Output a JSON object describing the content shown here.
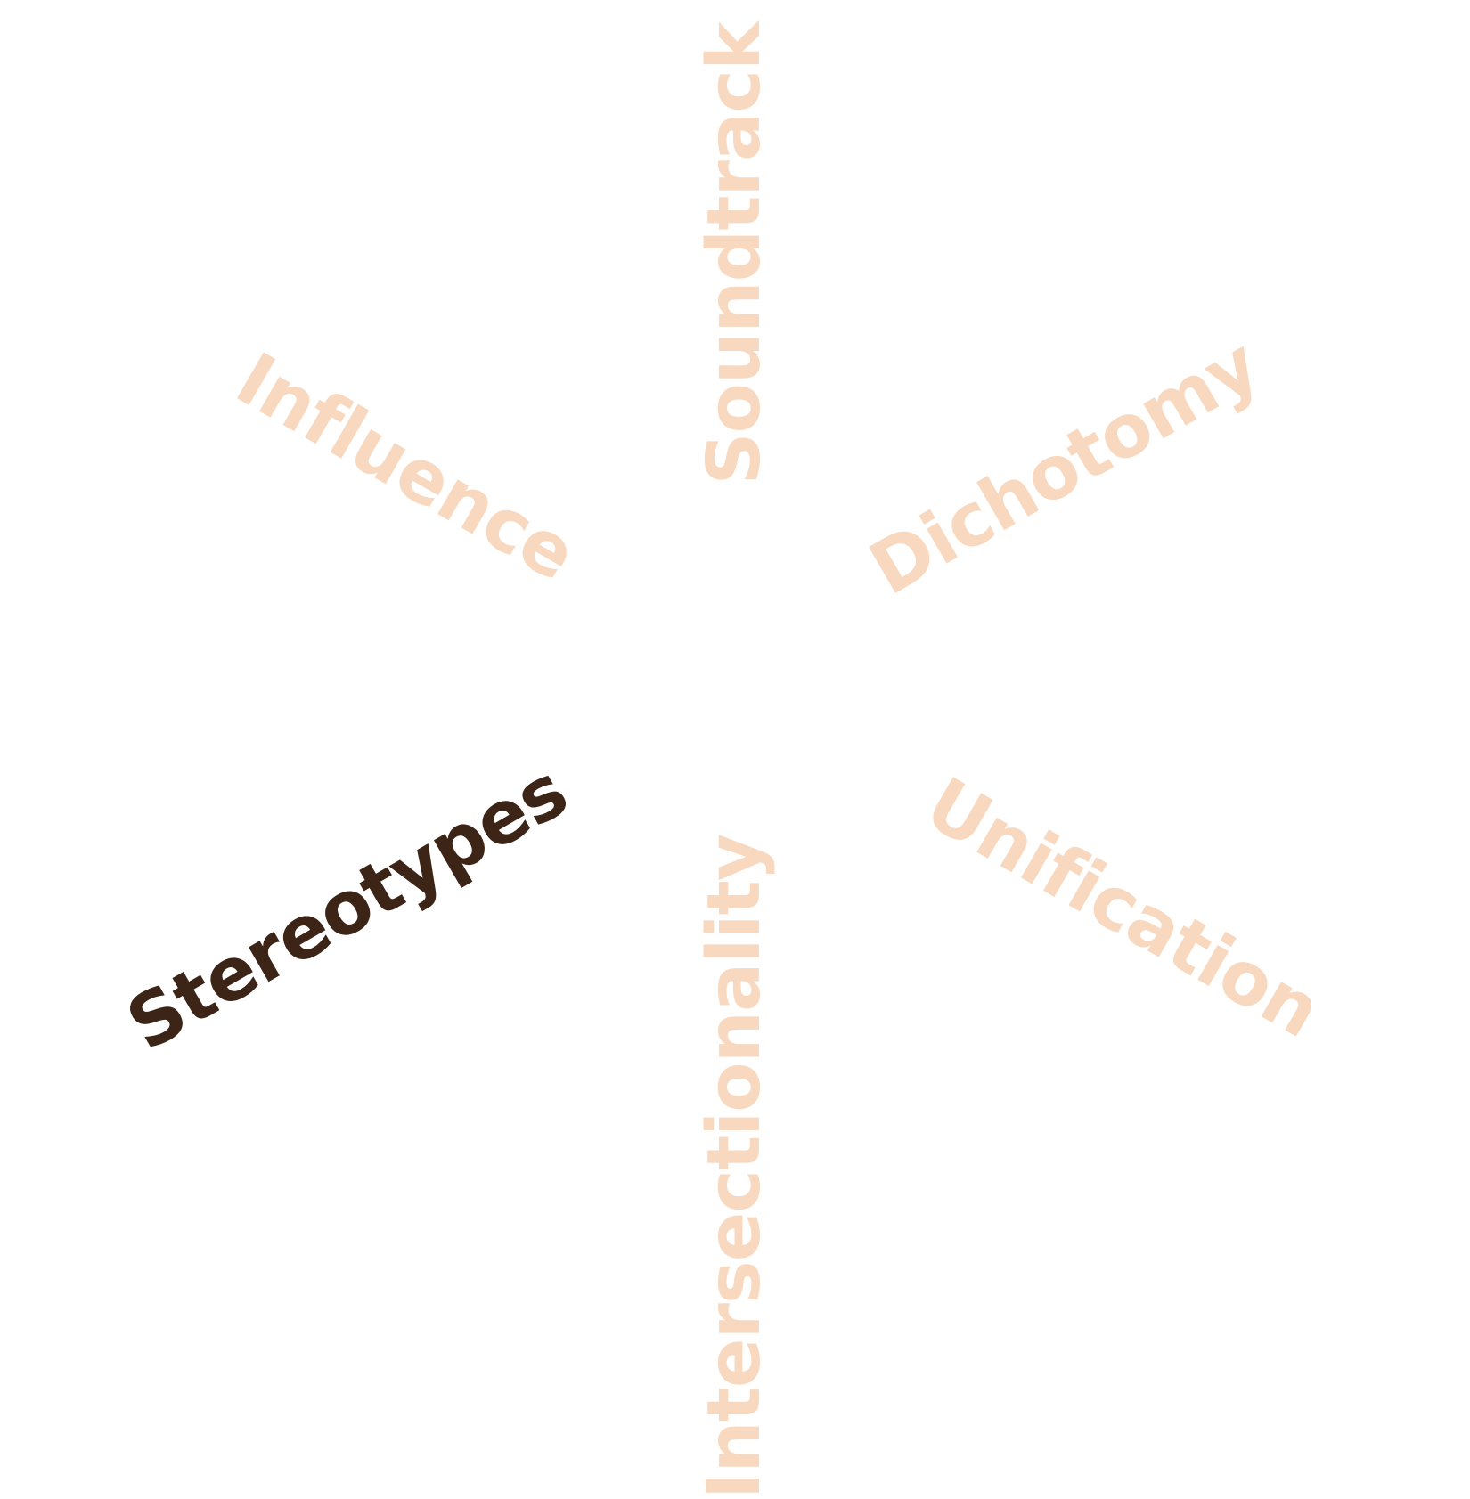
{
  "colors": {
    "inactive": "#f8d9bf",
    "active": "#3c2416",
    "background": "#ffffff"
  },
  "words": {
    "soundtrack": "Soundtrack",
    "dichotomy": "Dichotomy",
    "unification": "Unification",
    "intersectionality": "Intersectionality",
    "stereotypes": "Stereotypes",
    "influence": "Influence"
  },
  "active_word": "Stereotypes"
}
